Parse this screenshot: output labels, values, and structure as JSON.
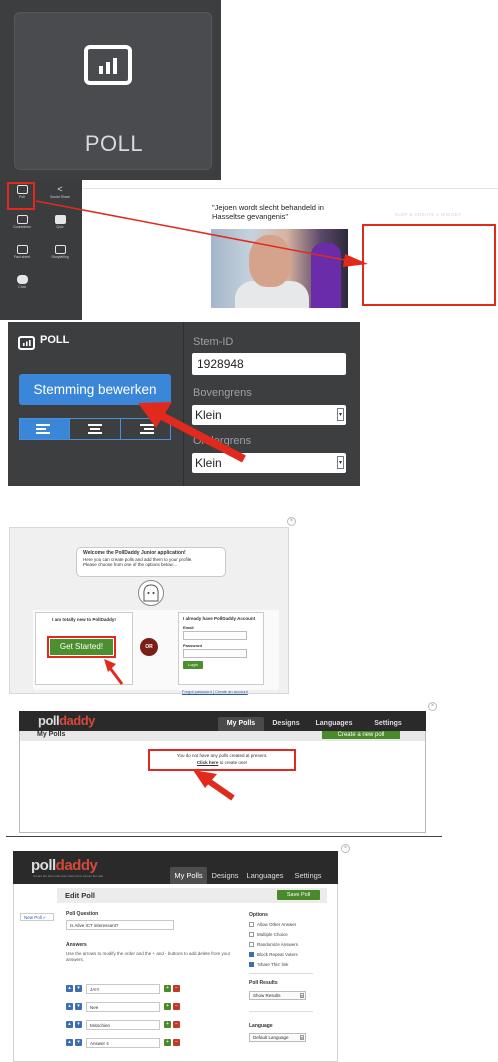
{
  "colors": {
    "highlight_red": "#e02a1d",
    "editor_dark": "#3d3e40",
    "button_blue": "#3a86d8",
    "polldaddy_green": "#4a8a2a"
  },
  "poll_tile": {
    "label": "POLL",
    "icon": "bar-chart-icon"
  },
  "widget_panel": {
    "items": [
      {
        "label": "Poll",
        "icon": "poll-icon"
      },
      {
        "label": "Social Share",
        "icon": "share-icon"
      },
      {
        "label": "Countdown",
        "icon": "countdown-icon"
      },
      {
        "label": "Quiz",
        "icon": "quiz-icon"
      },
      {
        "label": "Fact sheet",
        "icon": "factsheet-icon"
      },
      {
        "label": "Storytelling",
        "icon": "storytelling-icon"
      },
      {
        "label": "Chat",
        "icon": "chat-icon"
      }
    ]
  },
  "article": {
    "title": "\"Jejoen wordt slecht behandeld in Hasseltse gevangenis\"",
    "drop_zone_label": "SLEP & CREATE A WIDGET"
  },
  "poll_settings": {
    "header": "POLL",
    "edit_button": "Stemming bewerken",
    "stem_id_label": "Stem-ID",
    "stem_id_value": "1928948",
    "upper_label": "Bovengrens",
    "upper_value": "Klein",
    "lower_label": "Ondergrens",
    "lower_value": "Klein",
    "align_selected": "left"
  },
  "junior_app": {
    "welcome_title": "Welcome the PollDaddy Junior application!",
    "welcome_line1": "Here you can create polls and add them to your profile.",
    "welcome_line2": "Please choose from one of the options below....",
    "new_heading": "I am totally new to PollDaddy!",
    "get_started": "Get Started!",
    "or": "OR",
    "have_heading": "I already have PollDaddy Account",
    "email_label": "Email",
    "password_label": "Password",
    "login": "Login",
    "forgot": "Forgot password",
    "create": "Create an account",
    "close": "×"
  },
  "my_polls": {
    "logo_a": "poll",
    "logo_b": "daddy",
    "tabs": [
      "My Polls",
      "Designs",
      "Languages",
      "Settings"
    ],
    "page_title": "My Polls",
    "new_poll_button": "Create a new poll",
    "message": "You do not have any polls created at present.",
    "click_here": "Click here",
    "click_here_rest": " to create one!",
    "close": "×"
  },
  "edit_poll": {
    "logo_a": "poll",
    "logo_b": "daddy",
    "tagline": "Create the best polls and share them across the web",
    "tabs": [
      "My Polls",
      "Designs",
      "Languages",
      "Settings"
    ],
    "page_title": "Edit Poll",
    "save_button": "Save Poll",
    "new_poll": "New Poll »",
    "question_heading": "Poll Question",
    "question_value": "Is Alive ICT interessant?",
    "answers_heading": "Answers",
    "answers_help": "Use the arrows to modify the order and the + and - buttons to add delete from your answers.",
    "answers": [
      "JA!!!",
      "Nee",
      "Misschien",
      "Answer 4"
    ],
    "options_heading": "Options",
    "options": [
      {
        "label": "Allow Other Answer",
        "checked": false
      },
      {
        "label": "Multiple Choice",
        "checked": false
      },
      {
        "label": "Randomize Answers",
        "checked": false
      },
      {
        "label": "Block Repeat Voters",
        "checked": true
      },
      {
        "label": "'Share This' link",
        "checked": true
      }
    ],
    "results_heading": "Poll Results",
    "results_value": "Show Results",
    "language_heading": "Language",
    "language_value": "Default Language",
    "close": "×"
  }
}
